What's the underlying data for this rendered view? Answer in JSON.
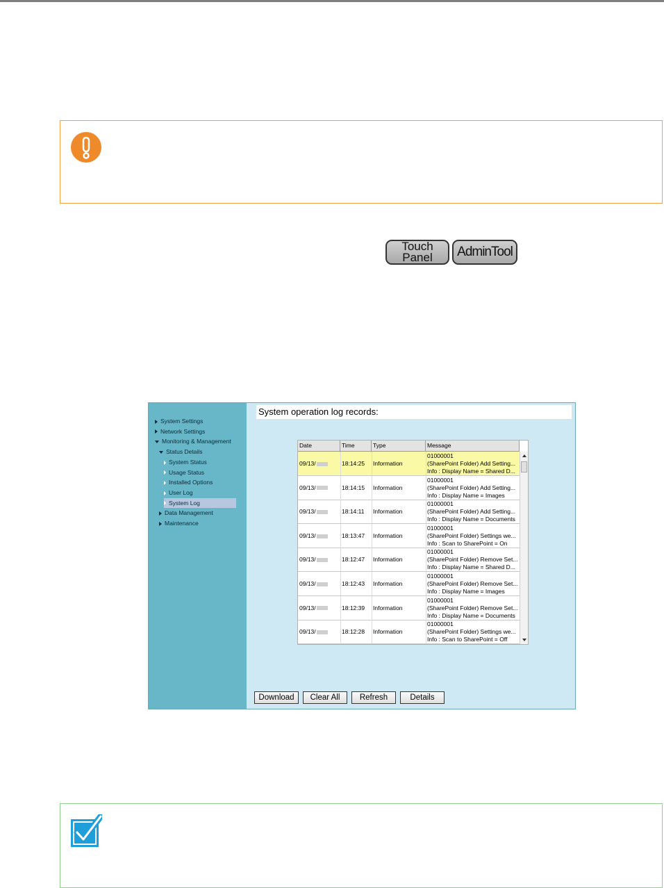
{
  "badges": {
    "touch_line1": "Touch",
    "touch_line2": "Panel",
    "admin": "AdminTool"
  },
  "screen": {
    "title": "System operation log records:",
    "sidebar": [
      {
        "label": "System Settings",
        "level": 0,
        "arrow": "right"
      },
      {
        "label": "Network Settings",
        "level": 0,
        "arrow": "right"
      },
      {
        "label": "Monitoring & Management",
        "level": 0,
        "arrow": "down"
      },
      {
        "label": "Status Details",
        "level": 1,
        "arrow": "down"
      },
      {
        "label": "System Status",
        "level": 2,
        "arrow": "right"
      },
      {
        "label": "Usage Status",
        "level": 2,
        "arrow": "right"
      },
      {
        "label": "Installed Options",
        "level": 2,
        "arrow": "right"
      },
      {
        "label": "User Log",
        "level": 2,
        "arrow": "right"
      },
      {
        "label": "System Log",
        "level": 2,
        "arrow": "right",
        "selected": true
      },
      {
        "label": "Data Management",
        "level": 1,
        "arrow": "right"
      },
      {
        "label": "Maintenance",
        "level": 1,
        "arrow": "right"
      }
    ],
    "columns": [
      "Date",
      "Time",
      "Type",
      "Message"
    ],
    "rows": [
      {
        "date": "09/13/",
        "time": "18:14:25",
        "type": "Information",
        "msg": [
          "01000001",
          "(SharePoint Folder) Add Setting...",
          "Info : Display Name = Shared D..."
        ],
        "highlighted": true
      },
      {
        "date": "09/13/",
        "time": "18:14:15",
        "type": "Information",
        "msg": [
          "01000001",
          "(SharePoint Folder) Add Setting...",
          "Info : Display Name = Images"
        ]
      },
      {
        "date": "09/13/",
        "time": "18:14:11",
        "type": "Information",
        "msg": [
          "01000001",
          "(SharePoint Folder) Add Setting...",
          "Info : Display Name = Documents"
        ]
      },
      {
        "date": "09/13/",
        "time": "18:13:47",
        "type": "Information",
        "msg": [
          "01000001",
          "(SharePoint Folder) Settings we...",
          "Info : Scan to SharePoint = On"
        ]
      },
      {
        "date": "09/13/",
        "time": "18:12:47",
        "type": "Information",
        "msg": [
          "01000001",
          "(SharePoint Folder) Remove Set...",
          "Info : Display Name = Shared D..."
        ]
      },
      {
        "date": "09/13/",
        "time": "18:12:43",
        "type": "Information",
        "msg": [
          "01000001",
          "(SharePoint Folder) Remove Set...",
          "Info : Display Name = Images"
        ]
      },
      {
        "date": "09/13/",
        "time": "18:12:39",
        "type": "Information",
        "msg": [
          "01000001",
          "(SharePoint Folder) Remove Set...",
          "Info : Display Name = Documents"
        ]
      },
      {
        "date": "09/13/",
        "time": "18:12:28",
        "type": "Information",
        "msg": [
          "01000001",
          "(SharePoint Folder) Settings we...",
          "Info : Scan to SharePoint = Off"
        ]
      }
    ],
    "buttons": {
      "download": "Download",
      "clear_all": "Clear All",
      "refresh": "Refresh",
      "details": "Details"
    }
  },
  "colors": {
    "caution_border": "#f0a040",
    "note_border": "#8fd08f",
    "sidebar": "#67b7c8",
    "panel": "#cfe9f4",
    "highlight_row": "#fafaa6"
  },
  "icons": {
    "caution": "exclamation-circle-icon",
    "note": "checkbox-check-icon"
  }
}
